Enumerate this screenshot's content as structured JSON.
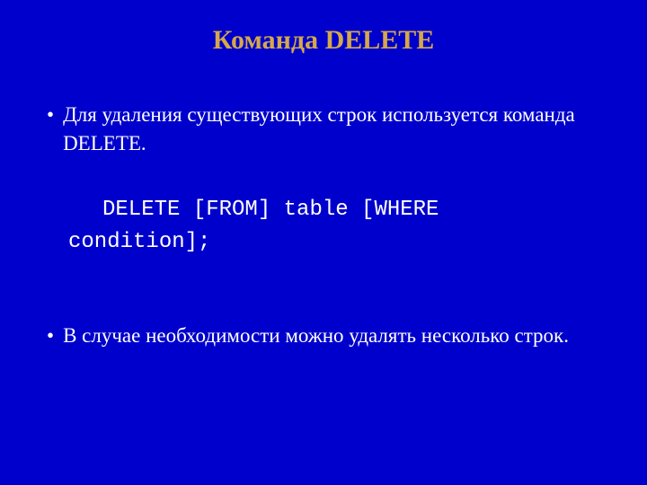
{
  "slide": {
    "title": "Команда DELETE",
    "bullet1": "Для удаления существующих строк используется команда DELETE.",
    "code_line1": "DELETE [FROM] table [WHERE",
    "code_line2": "condition];",
    "bullet2": "В случае необходимости можно удалять несколько строк."
  }
}
